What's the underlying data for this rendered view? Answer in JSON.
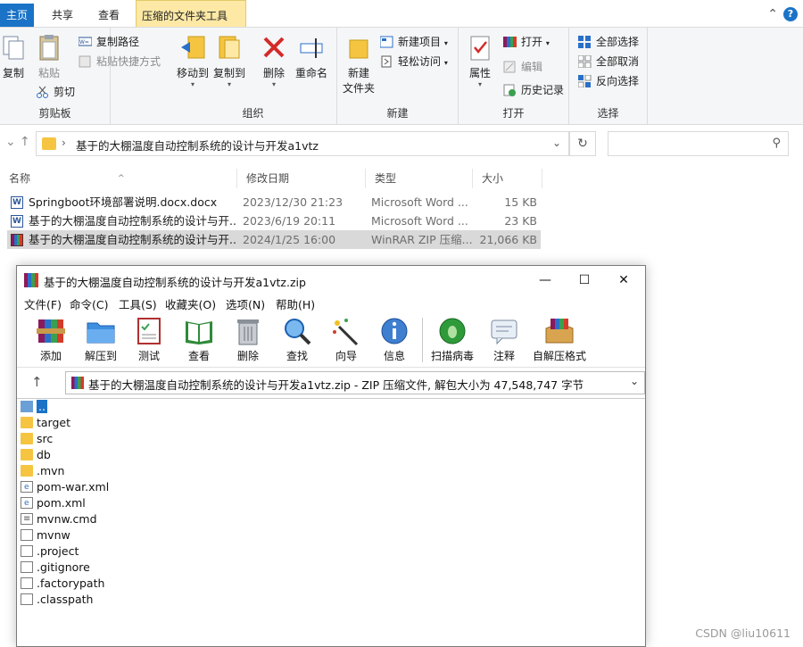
{
  "ribbon_tabs": [
    "主页",
    "共享",
    "查看",
    "压缩的文件夹工具"
  ],
  "ribbon": {
    "clipboard": {
      "label": "剪贴板",
      "copy": "复制",
      "paste": "粘贴",
      "copy_path": "复制路径",
      "paste_shortcut": "粘贴快捷方式",
      "cut": "剪切"
    },
    "organize": {
      "label": "组织",
      "move_to": "移动到",
      "copy_to": "复制到",
      "delete": "删除",
      "rename": "重命名"
    },
    "new": {
      "label": "新建",
      "new_folder": "新建\n文件夹",
      "new_folder_l1": "新建",
      "new_folder_l2": "文件夹",
      "new_item": "新建项目",
      "easy_access": "轻松访问"
    },
    "open": {
      "label": "打开",
      "properties": "属性",
      "open": "打开",
      "edit": "编辑",
      "history": "历史记录"
    },
    "select": {
      "label": "选择",
      "select_all": "全部选择",
      "select_none": "全部取消",
      "invert": "反向选择"
    }
  },
  "address": {
    "path": "基于的大棚温度自动控制系统的设计与开发a1vtz"
  },
  "filelist": {
    "columns": [
      "名称",
      "修改日期",
      "类型",
      "大小"
    ],
    "rows": [
      {
        "name": "Springboot环境部署说明.docx.docx",
        "date": "2023/12/30 21:23",
        "type": "Microsoft Word ...",
        "size": "15 KB",
        "icon": "word-icon"
      },
      {
        "name": "基于的大棚温度自动控制系统的设计与开...",
        "date": "2023/6/19 20:11",
        "type": "Microsoft Word ...",
        "size": "23 KB",
        "icon": "word-icon"
      },
      {
        "name": "基于的大棚温度自动控制系统的设计与开...",
        "date": "2024/1/25 16:00",
        "type": "WinRAR ZIP 压缩...",
        "size": "21,066 KB",
        "icon": "winrar-icon"
      }
    ]
  },
  "winrar": {
    "title": "基于的大棚温度自动控制系统的设计与开发a1vtz.zip",
    "menu": [
      "文件(F)",
      "命令(C)",
      "工具(S)",
      "收藏夹(O)",
      "选项(N)",
      "帮助(H)"
    ],
    "toolbar": [
      "添加",
      "解压到",
      "测试",
      "查看",
      "删除",
      "查找",
      "向导",
      "信息",
      "扫描病毒",
      "注释",
      "自解压格式"
    ],
    "address": "基于的大棚温度自动控制系统的设计与开发a1vtz.zip - ZIP 压缩文件, 解包大小为 47,548,747 字节",
    "items": [
      {
        "name": "..",
        "kind": "folder-up"
      },
      {
        "name": "target",
        "kind": "folder"
      },
      {
        "name": "src",
        "kind": "folder"
      },
      {
        "name": "db",
        "kind": "folder"
      },
      {
        "name": ".mvn",
        "kind": "folder"
      },
      {
        "name": "pom-war.xml",
        "kind": "xml"
      },
      {
        "name": "pom.xml",
        "kind": "xml"
      },
      {
        "name": "mvnw.cmd",
        "kind": "cmd"
      },
      {
        "name": "mvnw",
        "kind": "doc"
      },
      {
        "name": ".project",
        "kind": "doc"
      },
      {
        "name": ".gitignore",
        "kind": "doc"
      },
      {
        "name": ".factorypath",
        "kind": "doc"
      },
      {
        "name": ".classpath",
        "kind": "doc"
      }
    ]
  },
  "watermark": "CSDN @liu10611",
  "colors": {
    "accent": "#1a73c6",
    "context_tab": "#fde9a5",
    "selected_row": "#d9d9d9",
    "folder": "#f5c542"
  }
}
